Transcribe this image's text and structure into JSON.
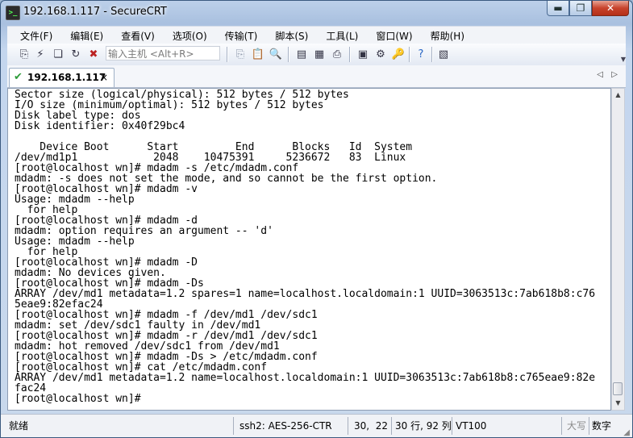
{
  "window": {
    "title": "192.168.1.117 - SecureCRT",
    "min": "▬",
    "max": "❐",
    "close": "✕"
  },
  "menu": [
    "文件(F)",
    "编辑(E)",
    "查看(V)",
    "选项(O)",
    "传输(T)",
    "脚本(S)",
    "工具(L)",
    "窗口(W)",
    "帮助(H)"
  ],
  "toolbar": {
    "quick_connect_placeholder": "输入主机 <Alt+R>"
  },
  "tab": {
    "label": "192.168.1.117",
    "close": "×",
    "prev": "◁",
    "next": "▷"
  },
  "terminal": {
    "lines": [
      "Sector size (logical/physical): 512 bytes / 512 bytes",
      "I/O size (minimum/optimal): 512 bytes / 512 bytes",
      "Disk label type: dos",
      "Disk identifier: 0x40f29bc4",
      "",
      "    Device Boot      Start         End      Blocks   Id  System",
      "/dev/md1p1            2048    10475391     5236672   83  Linux",
      "[root@localhost wn]# mdadm -s /etc/mdadm.conf",
      "mdadm: -s does not set the mode, and so cannot be the first option.",
      "[root@localhost wn]# mdadm -v",
      "Usage: mdadm --help",
      "  for help",
      "[root@localhost wn]# mdadm -d",
      "mdadm: option requires an argument -- 'd'",
      "Usage: mdadm --help",
      "  for help",
      "[root@localhost wn]# mdadm -D",
      "mdadm: No devices given.",
      "[root@localhost wn]# mdadm -Ds",
      "ARRAY /dev/md1 metadata=1.2 spares=1 name=localhost.localdomain:1 UUID=3063513c:7ab618b8:c76",
      "5eae9:82efac24",
      "[root@localhost wn]# mdadm -f /dev/md1 /dev/sdc1",
      "mdadm: set /dev/sdc1 faulty in /dev/md1",
      "[root@localhost wn]# mdadm -r /dev/md1 /dev/sdc1",
      "mdadm: hot removed /dev/sdc1 from /dev/md1",
      "[root@localhost wn]# mdadm -Ds > /etc/mdadm.conf",
      "[root@localhost wn]# cat /etc/mdadm.conf",
      "ARRAY /dev/md1 metadata=1.2 name=localhost.localdomain:1 UUID=3063513c:7ab618b8:c765eae9:82e",
      "fac24",
      "[root@localhost wn]#"
    ]
  },
  "status": {
    "ready": "就绪",
    "cipher": "ssh2: AES-256-CTR",
    "cursor": "30,  22",
    "rows_cols": "30 行, 92 列",
    "term_type": "VT100",
    "caps": "大写",
    "num": "数字"
  }
}
